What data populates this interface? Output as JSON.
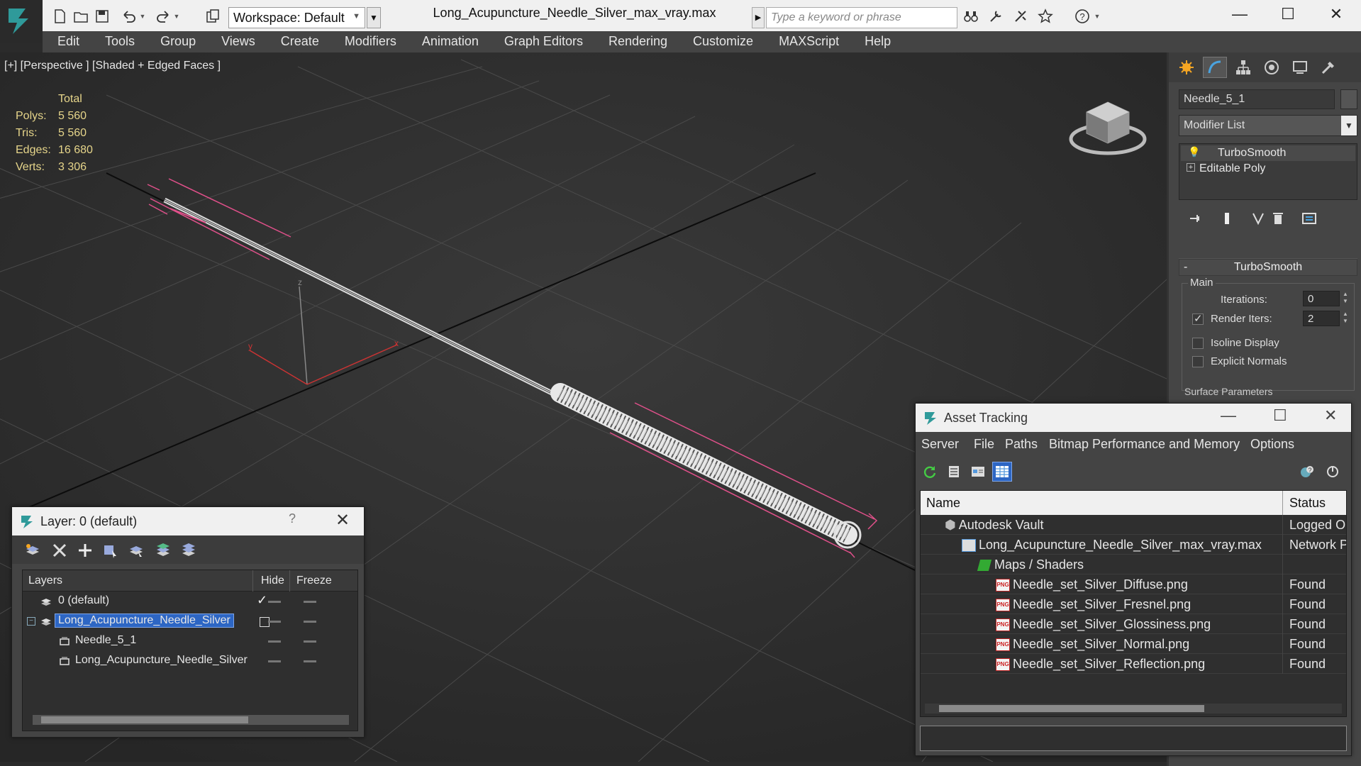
{
  "app": {
    "document_title": "Long_Acupuncture_Needle_Silver_max_vray.max",
    "workspace_label": "Workspace: Default",
    "search_placeholder": "Type a keyword or phrase"
  },
  "menubar": [
    "Edit",
    "Tools",
    "Group",
    "Views",
    "Create",
    "Modifiers",
    "Animation",
    "Graph Editors",
    "Rendering",
    "Customize",
    "MAXScript",
    "Help"
  ],
  "viewport": {
    "label": "[+] [Perspective ] [Shaded + Edged Faces ]",
    "stats": {
      "header": "Total",
      "rows": [
        {
          "label": "Polys:",
          "value": "5 560"
        },
        {
          "label": "Tris:",
          "value": "5 560"
        },
        {
          "label": "Edges:",
          "value": "16 680"
        },
        {
          "label": "Verts:",
          "value": "3 306"
        }
      ]
    },
    "axis_labels": {
      "z": "z",
      "x": "x",
      "y": "y"
    }
  },
  "command_panel": {
    "object_name": "Needle_5_1",
    "modifier_list_label": "Modifier List",
    "stack": [
      "TurboSmooth",
      "Editable Poly"
    ],
    "turbosmooth": {
      "title": "TurboSmooth",
      "group_main": "Main",
      "iterations_label": "Iterations:",
      "iterations_value": "0",
      "render_iters_label": "Render Iters:",
      "render_iters_value": "2",
      "isoline_label": "Isoline Display",
      "explicit_normals_label": "Explicit Normals",
      "surface_params_label": "Surface Parameters"
    }
  },
  "layer_dialog": {
    "title": "Layer: 0 (default)",
    "help": "?",
    "columns": {
      "layers": "Layers",
      "hide": "Hide",
      "freeze": "Freeze"
    },
    "rows": [
      {
        "name": "0 (default)"
      },
      {
        "name": "Long_Acupuncture_Needle_Silver"
      },
      {
        "name": "Needle_5_1"
      },
      {
        "name": "Long_Acupuncture_Needle_Silver"
      }
    ]
  },
  "asset_dialog": {
    "title": "Asset Tracking",
    "menu": [
      "Server",
      "File",
      "Paths",
      "Bitmap Performance and Memory",
      "Options"
    ],
    "columns": {
      "name": "Name",
      "status": "Status"
    },
    "rows": [
      {
        "name": "Autodesk Vault",
        "status": "Logged Ou"
      },
      {
        "name": "Long_Acupuncture_Needle_Silver_max_vray.max",
        "status": "Network Pa"
      },
      {
        "name": "Maps / Shaders",
        "status": ""
      },
      {
        "name": "Needle_set_Silver_Diffuse.png",
        "status": "Found"
      },
      {
        "name": "Needle_set_Silver_Fresnel.png",
        "status": "Found"
      },
      {
        "name": "Needle_set_Silver_Glossiness.png",
        "status": "Found"
      },
      {
        "name": "Needle_set_Silver_Normal.png",
        "status": "Found"
      },
      {
        "name": "Needle_set_Silver_Reflection.png",
        "status": "Found"
      }
    ],
    "png_badge": "PNG"
  },
  "colors": {
    "selection_blue": "#2d66c4",
    "stats_yellow": "#e6d58a",
    "selection_pink": "#e0508a"
  }
}
